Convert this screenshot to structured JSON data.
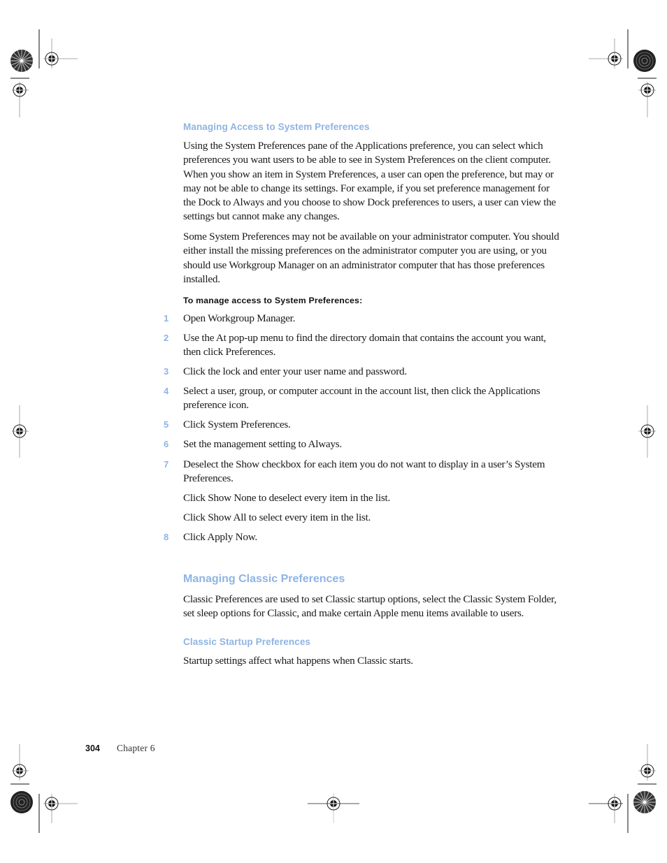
{
  "section1": {
    "heading": "Managing Access to System Preferences",
    "paragraphs": [
      "Using the System Preferences pane of the Applications preference, you can select which preferences you want users to be able to see in System Preferences on the client computer. When you show an item in System Preferences, a user can open the preference, but may or may not be able to change its settings. For example, if you set preference management for the Dock to Always and you choose to show Dock preferences to users, a user can view the settings but cannot make any changes.",
      "Some System Preferences may not be available on your administrator computer. You should either install the missing preferences on the administrator computer you are using, or you should use Workgroup Manager on an administrator computer that has those preferences installed."
    ],
    "task_heading": "To manage access to System Preferences:",
    "steps": [
      {
        "num": "1",
        "text": "Open Workgroup Manager."
      },
      {
        "num": "2",
        "text": "Use the At pop-up menu to find the directory domain that contains the account you want, then click Preferences."
      },
      {
        "num": "3",
        "text": "Click the lock and enter your user name and password."
      },
      {
        "num": "4",
        "text": "Select a user, group, or computer account in the account list, then click the Applications preference icon."
      },
      {
        "num": "5",
        "text": "Click System Preferences."
      },
      {
        "num": "6",
        "text": "Set the management setting to Always."
      },
      {
        "num": "7",
        "text": "Deselect the Show checkbox for each item you do not want to display in a user’s System Preferences."
      },
      {
        "num": "",
        "text": "Click Show None to deselect every item in the list."
      },
      {
        "num": "",
        "text": "Click Show All to select every item in the list."
      },
      {
        "num": "8",
        "text": "Click Apply Now."
      }
    ]
  },
  "section2": {
    "heading": "Managing Classic Preferences",
    "paragraph": "Classic Preferences are used to set Classic startup options, select the Classic System Folder, set sleep options for Classic, and make certain Apple menu items available to users.",
    "subheading": "Classic Startup Preferences",
    "sub_paragraph": "Startup settings affect what happens when Classic starts."
  },
  "footer": {
    "page_number": "304",
    "chapter": "Chapter  6"
  },
  "colors": {
    "heading_accent": "#8fb4e3",
    "body_text": "#1a1a1a"
  }
}
